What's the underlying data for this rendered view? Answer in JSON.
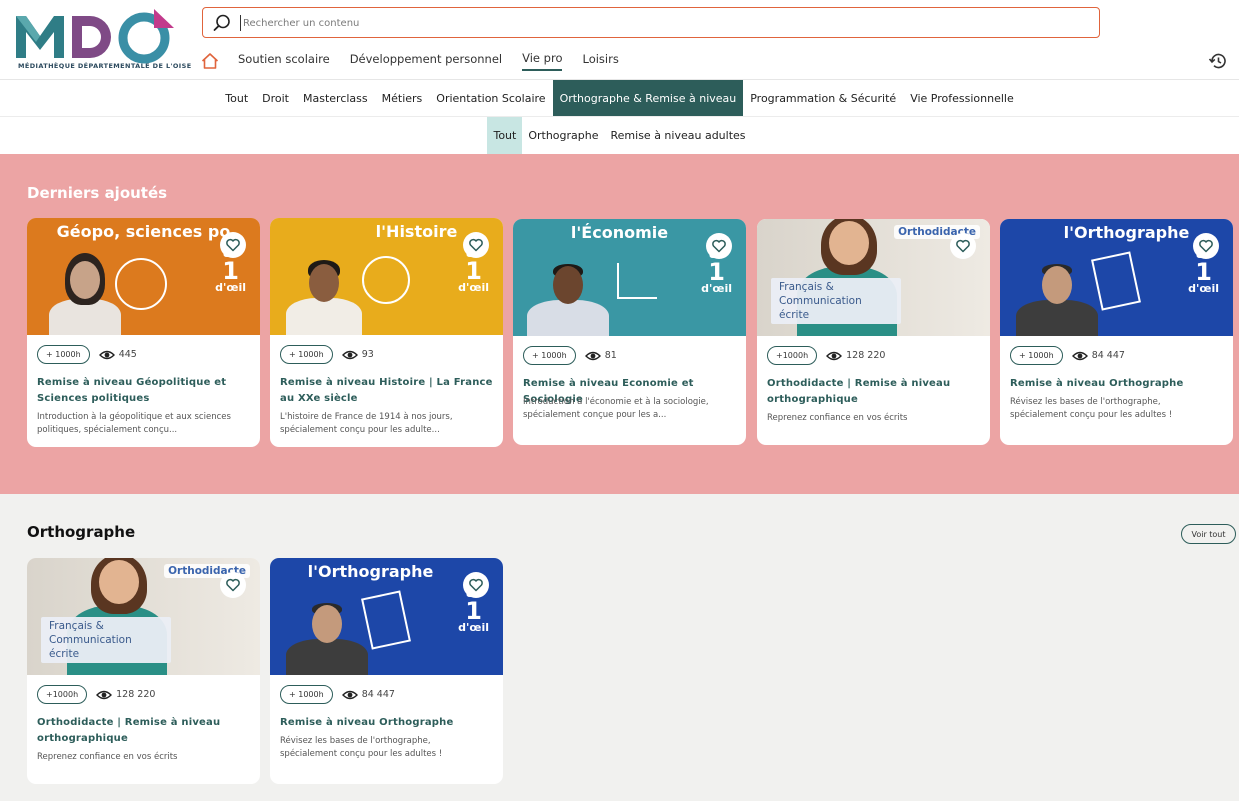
{
  "logo": {
    "text": "MDO",
    "subtitle": "MÉDIATHÈQUE DÉPARTEMENTALE DE L'OISE"
  },
  "search": {
    "placeholder": "Rechercher un contenu",
    "value": ""
  },
  "main_nav": [
    {
      "label": "Soutien scolaire",
      "active": false
    },
    {
      "label": "Développement personnel",
      "active": false
    },
    {
      "label": "Vie pro",
      "active": true
    },
    {
      "label": "Loisirs",
      "active": false
    }
  ],
  "categories": [
    {
      "label": "Tout",
      "active": false
    },
    {
      "label": "Droit",
      "active": false
    },
    {
      "label": "Masterclass",
      "active": false
    },
    {
      "label": "Métiers",
      "active": false
    },
    {
      "label": "Orientation Scolaire",
      "active": false
    },
    {
      "label": "Orthographe & Remise à niveau",
      "active": true
    },
    {
      "label": "Programmation & Sécurité",
      "active": false
    },
    {
      "label": "Vie Professionnelle",
      "active": false
    }
  ],
  "subcategories": [
    {
      "label": "Tout",
      "active": true
    },
    {
      "label": "Orthographe",
      "active": false
    },
    {
      "label": "Remise à niveau adultes",
      "active": false
    }
  ],
  "latest": {
    "title": "Derniers ajoutés",
    "cards": [
      {
        "thumb_title": "Géopo, sciences po",
        "thumb_color": "#dc7a1e",
        "duration": "+ 1000h",
        "views": "445",
        "title": "Remise à niveau Géopolitique et Sciences politiques",
        "description": "Introduction à la géopolitique et aux sciences politiques, spécialement conçu..."
      },
      {
        "thumb_title": "l'Histoire",
        "thumb_color": "#e8ac1c",
        "duration": "+ 1000h",
        "views": "93",
        "title": "Remise à niveau Histoire | La France au XXe siècle",
        "description": "L'histoire de France de 1914 à nos jours, spécialement conçu pour les adulte..."
      },
      {
        "thumb_title": "l'Économie",
        "thumb_color": "#3a97a4",
        "duration": "+ 1000h",
        "views": "81",
        "title": "Remise à niveau Economie et Sociologie",
        "description": "Introduction à l'économie et à la sociologie, spécialement conçue pour les a..."
      },
      {
        "brand": "Orthodidacte",
        "badge": "Français & Communication écrite",
        "thumb_color": "#cfcac1",
        "duration": "+1000h",
        "views": "128 220",
        "title": "Orthodidacte | Remise à niveau orthographique",
        "description": "Reprenez confiance en vos écrits"
      },
      {
        "thumb_title": "l'Orthographe",
        "thumb_color": "#1d47a8",
        "duration": "+ 1000h",
        "views": "84 447",
        "title": "Remise à niveau Orthographe",
        "description": "Révisez les bases de l'orthographe, spécialement conçu pour les adultes !"
      }
    ]
  },
  "orthographe": {
    "title": "Orthographe",
    "see_all": "Voir tout",
    "cards": [
      {
        "brand": "Orthodidacte",
        "badge": "Français & Communication écrite",
        "thumb_color": "#cfcac1",
        "duration": "+1000h",
        "views": "128 220",
        "title": "Orthodidacte | Remise à niveau orthographique",
        "description": "Reprenez confiance en vos écrits"
      },
      {
        "thumb_title": "l'Orthographe",
        "thumb_color": "#1d47a8",
        "duration": "+ 1000h",
        "views": "84 447",
        "title": "Remise à niveau Orthographe",
        "description": "Révisez les bases de l'orthographe, spécialement conçu pour les adultes !"
      }
    ]
  },
  "thumb_overlay": {
    "prefix": "en",
    "number": "1",
    "superscript": "er",
    "suffix": "d'œil"
  },
  "colors": {
    "accent": "#2d5d5a",
    "search_border": "#e0643c",
    "latest_background": "#eca4a4",
    "page_background": "#f1f1ef"
  }
}
